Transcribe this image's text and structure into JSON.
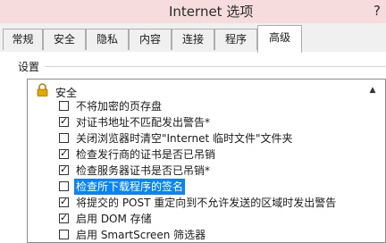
{
  "window": {
    "title": "Internet 选项",
    "help": "?"
  },
  "tabs": [
    "常规",
    "安全",
    "隐私",
    "内容",
    "连接",
    "程序",
    "高级"
  ],
  "active_tab": "高级",
  "settings": {
    "label": "设置",
    "group_label": "安全",
    "items": [
      {
        "label": "不将加密的页存盘",
        "checked": false
      },
      {
        "label": "对证书地址不匹配发出警告*",
        "checked": true
      },
      {
        "label": "关闭浏览器时清空\"Internet 临时文件\"文件夹",
        "checked": false
      },
      {
        "label": "检查发行商的证书是否已吊销",
        "checked": true
      },
      {
        "label": "检查服务器证书是否已吊销*",
        "checked": true
      },
      {
        "label": "检查所下载程序的签名",
        "checked": false,
        "selected": true
      },
      {
        "label": "将提交的 POST 重定向到不允许发送的区域时发出警告",
        "checked": true
      },
      {
        "label": "启用 DOM 存储",
        "checked": true
      },
      {
        "label": "启用 SmartScreen 筛选器",
        "checked": false
      }
    ]
  },
  "colors": {
    "titlebar": "#f6dcdd",
    "selection": "#0a84f5",
    "lock": "#e0a800"
  }
}
